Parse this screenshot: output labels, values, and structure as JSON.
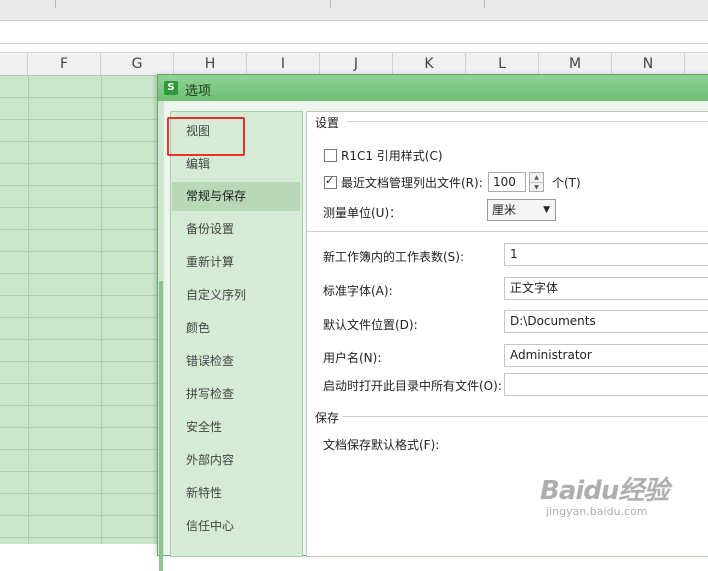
{
  "columns": [
    "F",
    "G",
    "H",
    "I",
    "J",
    "K",
    "L",
    "M",
    "N"
  ],
  "dialog": {
    "title": "选项",
    "icon_letter": "S",
    "nav": [
      {
        "label": "视图"
      },
      {
        "label": "编辑"
      },
      {
        "label": "常规与保存",
        "active": true
      },
      {
        "label": "备份设置"
      },
      {
        "label": "重新计算"
      },
      {
        "label": "自定义序列"
      },
      {
        "label": "颜色"
      },
      {
        "label": "错误检查"
      },
      {
        "label": "拼写检查"
      },
      {
        "label": "安全性"
      },
      {
        "label": "外部内容"
      },
      {
        "label": "新特性"
      },
      {
        "label": "信任中心"
      }
    ],
    "settings": {
      "section_title": "设置",
      "r1c1_label": "R1C1 引用样式(C)",
      "r1c1_checked": false,
      "recent_label": "最近文档管理列出文件(R):",
      "recent_checked": true,
      "recent_value": "100",
      "recent_unit": "个(T)",
      "measure_label": "测量单位(U)：",
      "measure_value": "厘米",
      "sheets_label": "新工作簿内的工作表数(S):",
      "sheets_value": "1",
      "font_label": "标准字体(A):",
      "font_value": "正文字体",
      "location_label": "默认文件位置(D):",
      "location_value": "D:\\Documents",
      "username_label": "用户名(N):",
      "username_value": "Administrator",
      "startup_label": "启动时打开此目录中所有文件(O):",
      "startup_value": ""
    },
    "save": {
      "section_title": "保存",
      "format_label": "文档保存默认格式(F):"
    }
  },
  "watermark": {
    "main": "Baidu经验",
    "sub": "jingyan.baidu.com"
  },
  "colors": {
    "highlight": "#e8312a",
    "title_bar": "#7cc47f",
    "sheet": "#c9e6cb"
  }
}
